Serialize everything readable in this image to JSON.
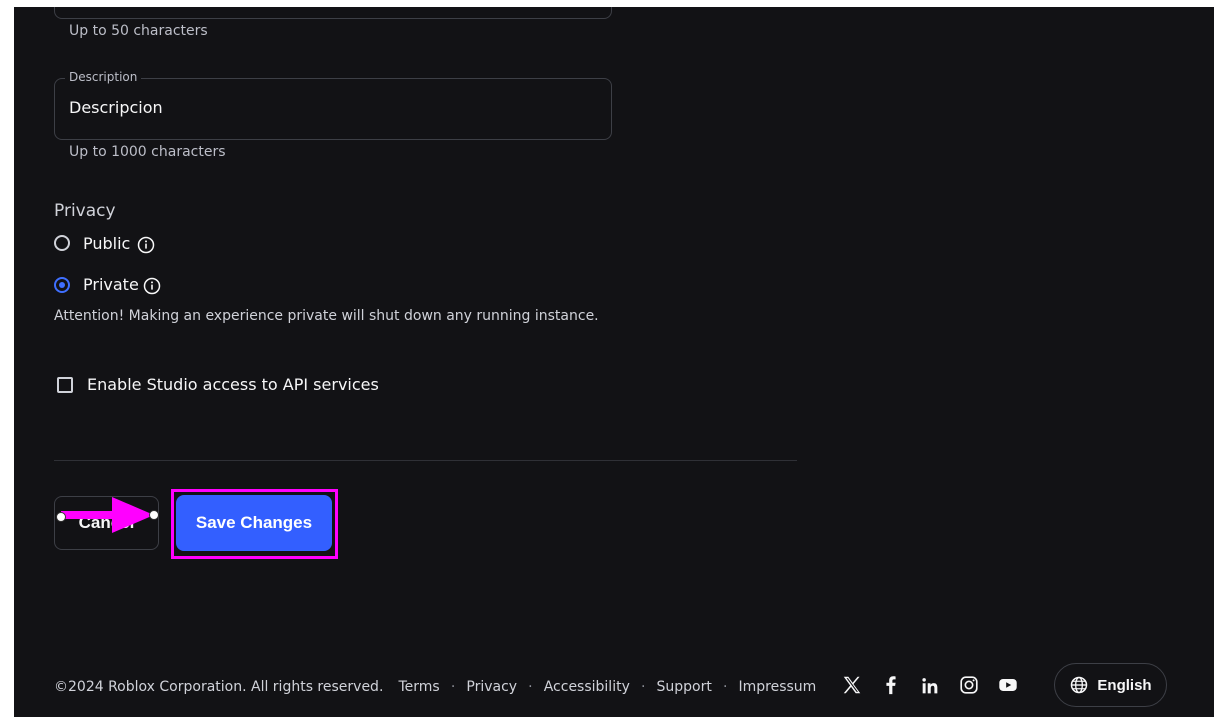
{
  "form": {
    "name_field": {
      "helper": "Up to 50 characters"
    },
    "description_field": {
      "legend": "Description",
      "value": "Descripcion",
      "helper": "Up to 1000 characters"
    },
    "privacy": {
      "heading": "Privacy",
      "options": [
        {
          "label": "Public",
          "selected": false,
          "icon": "info-icon"
        },
        {
          "label": "Private",
          "selected": true,
          "icon": "info-icon"
        }
      ],
      "attention": "Attention! Making an experience private will shut down any running instance."
    },
    "studio_access": {
      "label": "Enable Studio access to API services",
      "checked": false
    },
    "actions": {
      "cancel_label": "Cancel",
      "cancel_visible_text": "Can  l",
      "save_label": "Save Changes"
    }
  },
  "annotation": {
    "arrow_color": "#ff00ff",
    "highlight_color": "#ff00ff"
  },
  "footer": {
    "copyright": "©2024 Roblox Corporation. All rights reserved.",
    "links": [
      "Terms",
      "Privacy",
      "Accessibility",
      "Support",
      "Impressum"
    ],
    "separator": "·",
    "social_icons": [
      "x-icon",
      "facebook-icon",
      "linkedin-icon",
      "instagram-icon",
      "youtube-icon"
    ],
    "language_label": "English"
  },
  "colors": {
    "background": "#121215",
    "accent": "#335fff",
    "text": "#f7f7f8",
    "muted": "#bcbec8"
  }
}
